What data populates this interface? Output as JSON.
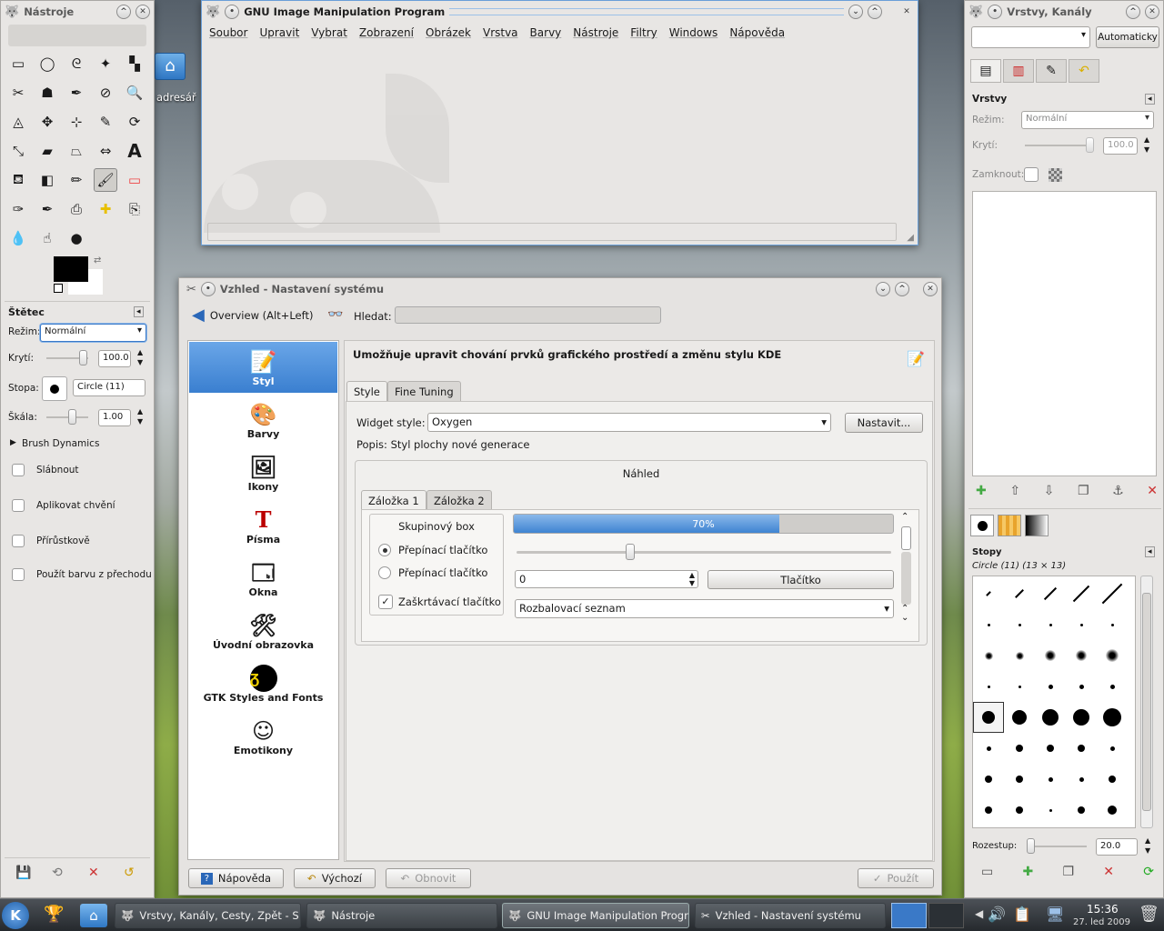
{
  "desktop": {
    "folder_label": "adresář"
  },
  "toolbox": {
    "title": "Nástroje",
    "tools": [
      "rect-select",
      "ellipse-select",
      "free-select",
      "fuzzy-select",
      "select-by-color",
      "scissors",
      "foreground-select",
      "paths",
      "color-picker",
      "zoom",
      "measure",
      "move",
      "align",
      "crop",
      "rotate",
      "scale",
      "shear",
      "perspective",
      "flip",
      "text",
      "bucket-fill",
      "blend",
      "pencil",
      "paintbrush",
      "eraser",
      "airbrush",
      "ink",
      "clone",
      "heal",
      "perspective-clone",
      "blur",
      "smudge",
      "dodge-burn"
    ],
    "options_title": "Štětec",
    "mode_label": "Režim:",
    "mode_value": "Normální",
    "opacity_label": "Krytí:",
    "opacity_value": "100.0",
    "brush_label": "Stopa:",
    "brush_value": "Circle (11)",
    "scale_label": "Škála:",
    "scale_value": "1.00",
    "dynamics_label": "Brush Dynamics",
    "checks": [
      "Slábnout",
      "Aplikovat chvění",
      "Přírůstkově",
      "Použít barvu z přechodu"
    ]
  },
  "gimp": {
    "title": "GNU Image Manipulation Program",
    "menu": [
      "Soubor",
      "Upravit",
      "Vybrat",
      "Zobrazení",
      "Obrázek",
      "Vrstva",
      "Barvy",
      "Nástroje",
      "Filtry",
      "Windows",
      "Nápověda"
    ]
  },
  "layers": {
    "title": "Vrstvy, Kanály",
    "auto_button": "Automaticky",
    "section_title": "Vrstvy",
    "mode_label": "Režim:",
    "mode_value": "Normální",
    "opacity_label": "Krytí:",
    "opacity_value": "100.0",
    "lock_label": "Zamknout:",
    "brushes_title": "Stopy",
    "brush_name": "Circle (11) (13 × 13)",
    "spacing_label": "Rozestup:",
    "spacing_value": "20.0"
  },
  "settings": {
    "title": "Vzhled - Nastavení systému",
    "overview_button": "Overview (Alt+Left)",
    "search_label": "Hledat:",
    "categories": [
      "Styl",
      "Barvy",
      "Ikony",
      "Písma",
      "Okna",
      "Úvodní obrazovka",
      "GTK Styles and Fonts",
      "Emotikony"
    ],
    "heading": "Umožňuje upravit chování prvků grafického prostředí a změnu stylu KDE",
    "tabs": [
      "Style",
      "Fine Tuning"
    ],
    "widget_style_label": "Widget style:",
    "widget_style_value": "Oxygen",
    "configure_button": "Nastavit...",
    "description": "Popis: Styl plochy nové generace",
    "preview_title": "Náhled",
    "preview_tabs": [
      "Záložka 1",
      "Záložka 2"
    ],
    "groupbox_title": "Skupinový box",
    "radio1": "Přepínací tlačítko",
    "radio2": "Přepínací tlačítko",
    "checkbox": "Zaškrtávací tlačítko",
    "progress": 0.7,
    "progress_text": "70%",
    "spin_value": "0",
    "button_label": "Tlačítko",
    "combo_value": "Rozbalovací seznam",
    "help_button": "Nápověda",
    "defaults_button": "Výchozí",
    "reset_button": "Obnovit",
    "apply_button": "Použít"
  },
  "taskbar": {
    "tasks": [
      "Vrstvy, Kanály, Cesty, Zpět - S",
      "Nástroje",
      "GNU Image Manipulation Progr",
      "Vzhled - Nastavení systému"
    ],
    "clock_time": "15:36",
    "clock_date": "27. led 2009"
  }
}
